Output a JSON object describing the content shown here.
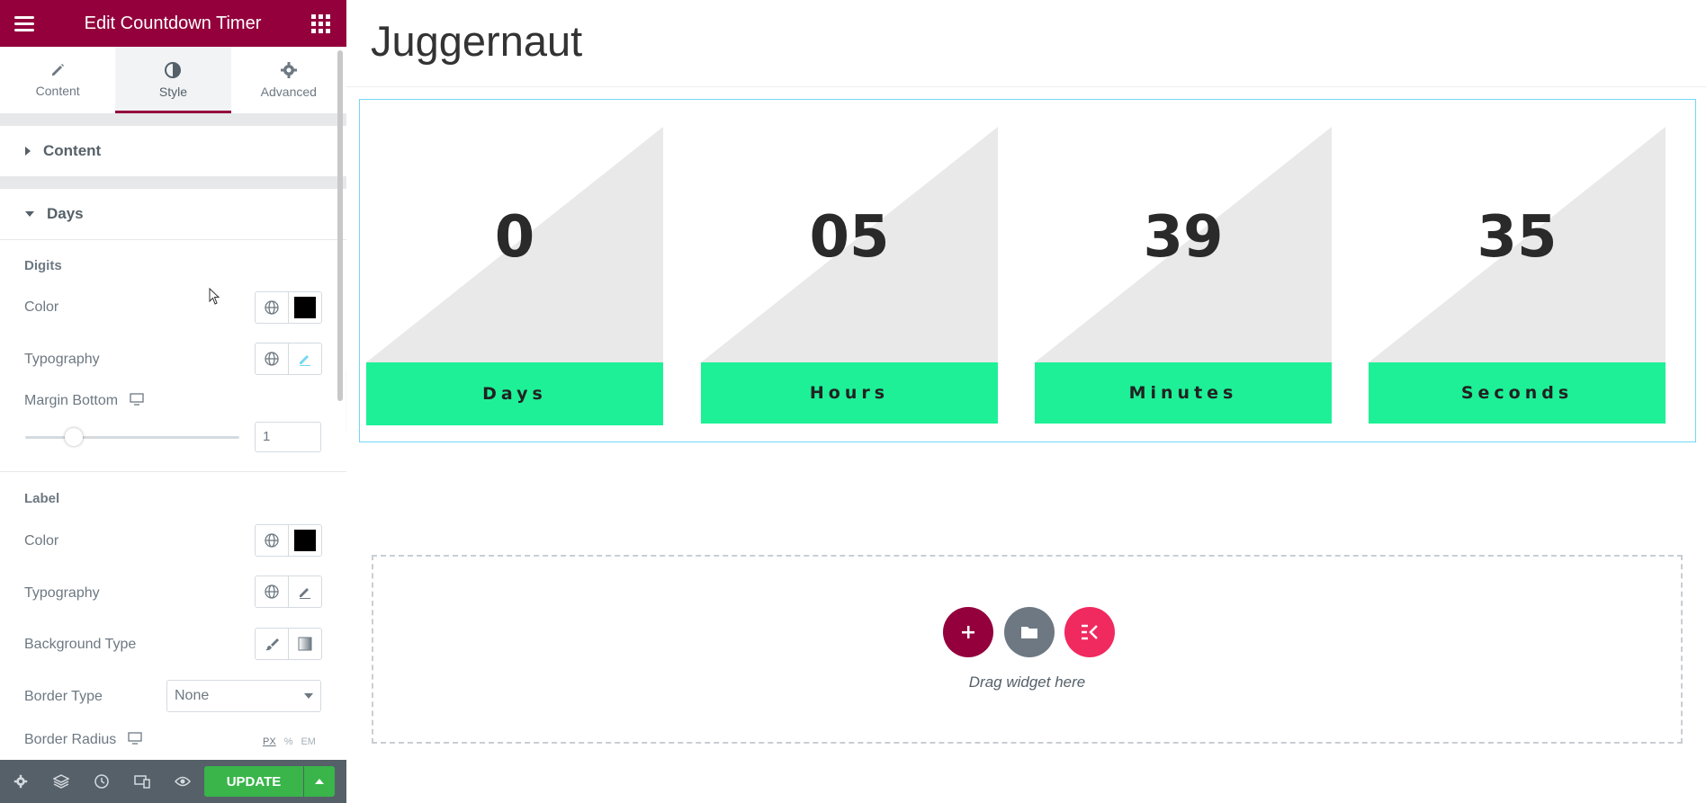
{
  "sidebar": {
    "header_title": "Edit Countdown Timer",
    "tabs": [
      {
        "label": "Content",
        "icon": "pencil-icon"
      },
      {
        "label": "Style",
        "icon": "contrast-icon"
      },
      {
        "label": "Advanced",
        "icon": "gear-icon"
      }
    ],
    "sections": {
      "content_title": "Content",
      "days_title": "Days"
    },
    "digits": {
      "heading": "Digits",
      "color_label": "Color",
      "typography_label": "Typography",
      "margin_bottom_label": "Margin Bottom",
      "margin_bottom_value": "1",
      "margin_bottom_slider_fraction": 0.12
    },
    "label_group": {
      "heading": "Label",
      "color_label": "Color",
      "typography_label": "Typography",
      "background_type_label": "Background Type",
      "border_type_label": "Border Type",
      "border_type_value": "None",
      "border_radius_label": "Border Radius",
      "units": [
        "PX",
        "%",
        "EM"
      ]
    },
    "footer": {
      "update_label": "UPDATE"
    },
    "colors": {
      "brand": "#93003c",
      "update": "#39b54a",
      "footer": "#556068"
    }
  },
  "canvas": {
    "page_title": "Juggernaut",
    "countdown": [
      {
        "value": "0",
        "label": "Days"
      },
      {
        "value": "05",
        "label": "Hours"
      },
      {
        "value": "39",
        "label": "Minutes"
      },
      {
        "value": "35",
        "label": "Seconds"
      }
    ],
    "label_bg_color": "#1ef097",
    "dropzone_text": "Drag widget here"
  }
}
